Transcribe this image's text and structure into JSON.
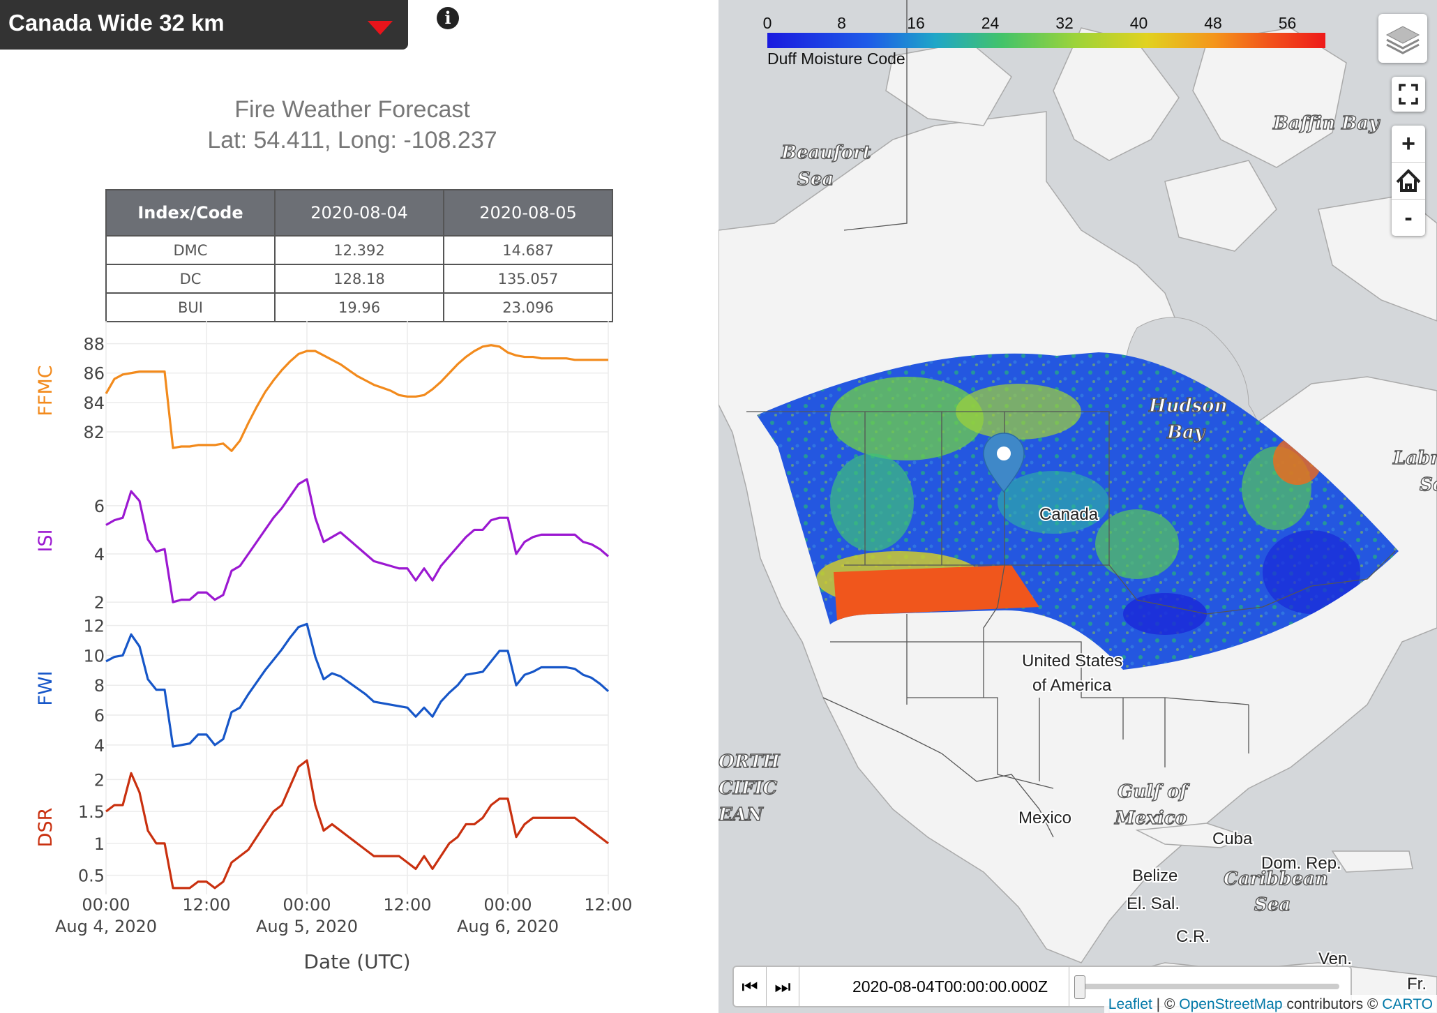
{
  "dropdown": {
    "label": "Canada Wide 32 km"
  },
  "forecast": {
    "title": "Fire Weather Forecast",
    "subtitle": "Lat: 54.411, Long: -108.237"
  },
  "table": {
    "headers": [
      "Index/Code",
      "2020-08-04",
      "2020-08-05"
    ],
    "rows": [
      {
        "code": "DMC",
        "d1": "12.392",
        "d2": "14.687"
      },
      {
        "code": "DC",
        "d1": "128.18",
        "d2": "135.057"
      },
      {
        "code": "BUI",
        "d1": "19.96",
        "d2": "23.096"
      }
    ]
  },
  "chart_data": {
    "type": "line",
    "x_label": "Date (UTC)",
    "x_range_hours": [
      0,
      60
    ],
    "x_ticks": [
      {
        "h": 0,
        "l1": "00:00",
        "l2": "Aug 4, 2020"
      },
      {
        "h": 12,
        "l1": "12:00",
        "l2": ""
      },
      {
        "h": 24,
        "l1": "00:00",
        "l2": "Aug 5, 2020"
      },
      {
        "h": 36,
        "l1": "12:00",
        "l2": ""
      },
      {
        "h": 48,
        "l1": "00:00",
        "l2": "Aug 6, 2020"
      },
      {
        "h": 60,
        "l1": "12:00",
        "l2": ""
      }
    ],
    "x_hours": [
      0,
      1,
      2,
      3,
      4,
      5,
      6,
      7,
      8,
      9,
      10,
      11,
      12,
      13,
      14,
      15,
      16,
      17,
      18,
      19,
      20,
      21,
      22,
      23,
      24,
      25,
      26,
      27,
      28,
      29,
      30,
      31,
      32,
      33,
      34,
      35,
      36,
      37,
      38,
      39,
      40,
      41,
      42,
      43,
      44,
      45,
      46,
      47,
      48,
      49,
      50,
      51,
      52,
      53,
      54,
      55,
      56,
      57,
      58,
      59,
      60
    ],
    "series": [
      {
        "name": "FFMC",
        "color": "#f28a1c",
        "yticks": [
          "88",
          "86",
          "84",
          "82"
        ],
        "tickvals": [
          88,
          86,
          84,
          82
        ],
        "ylim": [
          81.0,
          88.6
        ],
        "values": [
          84.6,
          85.6,
          85.9,
          86.0,
          86.1,
          86.1,
          86.1,
          86.1,
          80.9,
          81.0,
          81.0,
          81.1,
          81.1,
          81.1,
          81.2,
          80.7,
          81.4,
          82.6,
          83.7,
          84.7,
          85.5,
          86.2,
          86.8,
          87.3,
          87.5,
          87.5,
          87.2,
          86.9,
          86.6,
          86.2,
          85.8,
          85.5,
          85.2,
          85.0,
          84.8,
          84.5,
          84.4,
          84.4,
          84.5,
          84.9,
          85.4,
          86.0,
          86.6,
          87.1,
          87.5,
          87.8,
          87.9,
          87.8,
          87.4,
          87.2,
          87.1,
          87.1,
          87.0,
          87.0,
          87.0,
          87.0,
          86.9,
          86.9,
          86.9,
          86.9,
          86.9
        ]
      },
      {
        "name": "ISI",
        "color": "#9b18d1",
        "yticks": [
          "6",
          "4",
          "2"
        ],
        "tickvals": [
          6,
          4,
          2
        ],
        "ylim": [
          1.8,
          7.3
        ],
        "values": [
          5.2,
          5.4,
          5.5,
          6.6,
          6.2,
          4.6,
          4.1,
          4.2,
          2.0,
          2.1,
          2.1,
          2.4,
          2.4,
          2.1,
          2.3,
          3.3,
          3.5,
          4.0,
          4.5,
          5.0,
          5.5,
          5.9,
          6.4,
          6.9,
          7.1,
          5.5,
          4.5,
          4.7,
          4.9,
          4.6,
          4.3,
          4.0,
          3.7,
          3.6,
          3.5,
          3.4,
          3.4,
          2.9,
          3.4,
          2.9,
          3.5,
          3.9,
          4.3,
          4.7,
          5.0,
          5.0,
          5.4,
          5.5,
          5.5,
          4.0,
          4.5,
          4.7,
          4.8,
          4.8,
          4.8,
          4.8,
          4.8,
          4.5,
          4.4,
          4.2,
          3.9
        ]
      },
      {
        "name": "FWI",
        "color": "#1656c8",
        "yticks": [
          "12",
          "10",
          "8",
          "6",
          "4"
        ],
        "tickvals": [
          12,
          10,
          8,
          6,
          4
        ],
        "ylim": [
          3.2,
          12.4
        ],
        "values": [
          9.6,
          9.9,
          10.0,
          11.4,
          10.6,
          8.4,
          7.7,
          7.7,
          3.9,
          4.0,
          4.1,
          4.7,
          4.7,
          4.0,
          4.4,
          6.2,
          6.5,
          7.4,
          8.2,
          9.0,
          9.7,
          10.4,
          11.2,
          11.9,
          12.1,
          9.9,
          8.4,
          8.8,
          8.6,
          8.2,
          7.8,
          7.4,
          6.9,
          6.8,
          6.7,
          6.6,
          6.5,
          5.9,
          6.5,
          5.9,
          6.9,
          7.5,
          8.0,
          8.7,
          8.8,
          8.9,
          9.6,
          10.3,
          10.3,
          8.0,
          8.7,
          8.9,
          9.2,
          9.2,
          9.2,
          9.2,
          9.1,
          8.7,
          8.5,
          8.1,
          7.6
        ]
      },
      {
        "name": "DSR",
        "color": "#c9300f",
        "yticks": [
          "2",
          "1.5",
          "1",
          "0.5"
        ],
        "tickvals": [
          2,
          1.5,
          1,
          0.5
        ],
        "ylim": [
          0.2,
          2.3
        ],
        "values": [
          1.5,
          1.6,
          1.6,
          2.1,
          1.8,
          1.2,
          1.0,
          1.0,
          0.3,
          0.3,
          0.3,
          0.4,
          0.4,
          0.3,
          0.4,
          0.7,
          0.8,
          0.9,
          1.1,
          1.3,
          1.5,
          1.6,
          1.9,
          2.2,
          2.3,
          1.6,
          1.2,
          1.3,
          1.2,
          1.1,
          1.0,
          0.9,
          0.8,
          0.8,
          0.8,
          0.8,
          0.7,
          0.6,
          0.8,
          0.6,
          0.8,
          1.0,
          1.1,
          1.3,
          1.3,
          1.4,
          1.6,
          1.7,
          1.7,
          1.1,
          1.3,
          1.4,
          1.4,
          1.4,
          1.4,
          1.4,
          1.4,
          1.3,
          1.2,
          1.1,
          1.0
        ]
      }
    ]
  },
  "map": {
    "legend": {
      "ticks": [
        "0",
        "8",
        "16",
        "24",
        "32",
        "40",
        "48",
        "56"
      ],
      "label": "Duff Moisture Code"
    },
    "labels": {
      "beaufort1": "Beaufort",
      "beaufort2": "Sea",
      "baffin": "Baffin Bay",
      "hudson1": "Hudson",
      "hudson2": "Bay",
      "labr1": "Labr",
      "labr2": "Se",
      "canada": "Canada",
      "usa1": "United States",
      "usa2": "of America",
      "north1": "ORTH",
      "north2": "CIFIC",
      "north3": "EAN",
      "gulf1": "Gulf of",
      "gulf2": "Mexico",
      "mexico": "Mexico",
      "cuba": "Cuba",
      "domrep": "Dom. Rep.",
      "carib1": "Caribbean",
      "carib2": "Sea",
      "belize": "Belize",
      "elsal": "El. Sal.",
      "cr": "C.R.",
      "ven": "Ven.",
      "fr": "Fr."
    },
    "zoom": {
      "in": "+",
      "home": "⌂",
      "out": "-"
    },
    "time": {
      "current": "2020-08-04T00:00:00.000Z",
      "back": "⏮",
      "fwd": "⏭"
    },
    "attribution": {
      "leaflet": "Leaflet",
      "sep1": " | © ",
      "osm": "OpenStreetMap",
      "sep2": " contributors © ",
      "carto": "CARTO"
    }
  }
}
